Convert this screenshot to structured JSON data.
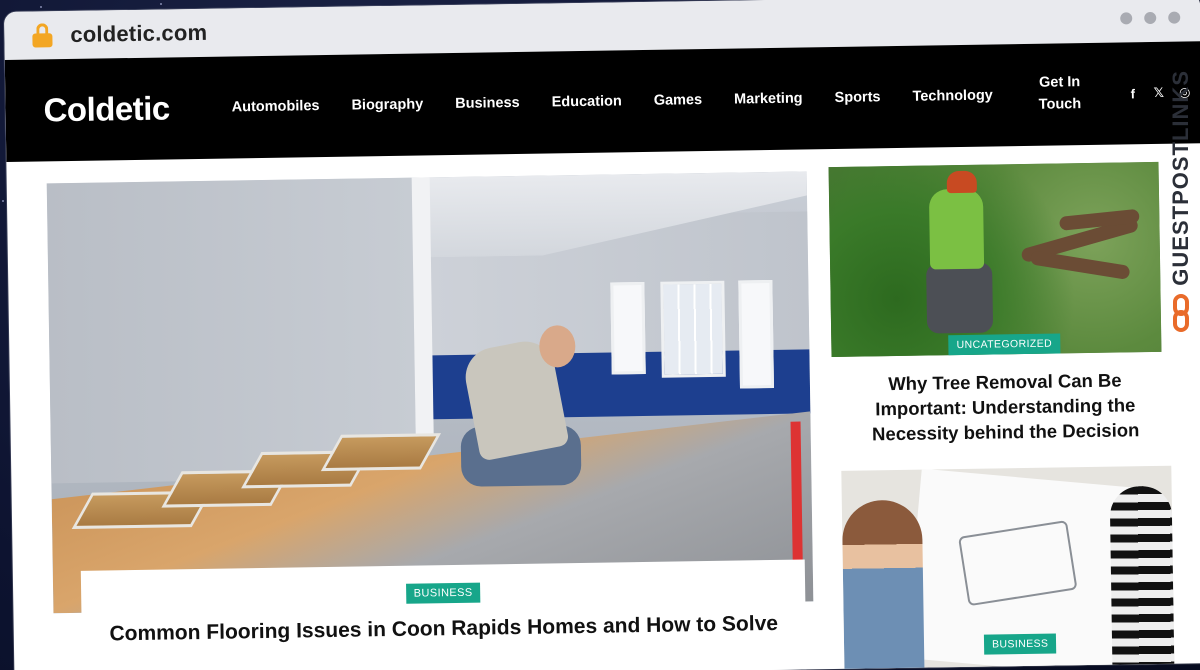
{
  "browser": {
    "url": "coldetic.com"
  },
  "site": {
    "logo": "Coldetic",
    "nav": [
      "Automobiles",
      "Biography",
      "Business",
      "Education",
      "Games",
      "Marketing",
      "Sports",
      "Technology"
    ],
    "contact_line1": "Get In",
    "contact_line2": "Touch",
    "social_icons": [
      "facebook-icon",
      "x-icon",
      "instagram-icon"
    ]
  },
  "hero": {
    "badge": "BUSINESS",
    "title": "Common Flooring Issues in Coon Rapids Homes and How to Solve"
  },
  "sidebar": {
    "post1": {
      "badge": "UNCATEGORIZED",
      "title": "Why Tree Removal Can Be Important: Understanding the Necessity behind the Decision"
    },
    "post2": {
      "badge": "BUSINESS"
    }
  },
  "watermark": {
    "text": "GUESTPOSTLINKS"
  },
  "colors": {
    "header_bg": "#000000",
    "badge_bg": "#17a68a",
    "lock": "#f3a623",
    "watermark_accent": "#e96b2a"
  }
}
